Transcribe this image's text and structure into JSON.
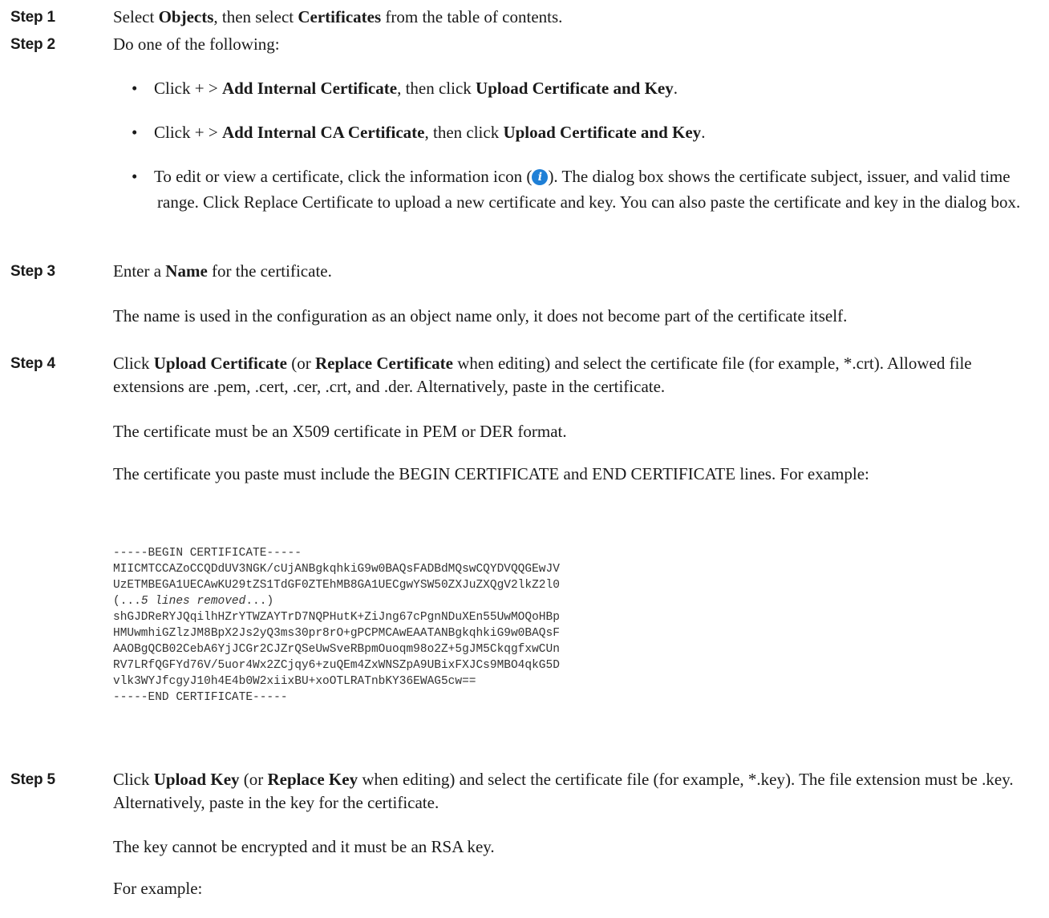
{
  "steps": [
    {
      "label": "Step 1",
      "text_a": "Select ",
      "bold_a": "Objects",
      "text_b": ", then select ",
      "bold_b": "Certificates",
      "text_c": " from the table of contents."
    },
    {
      "label": "Step 2",
      "text": "Do one of the following:",
      "bullets": [
        {
          "text_a": "Click + > ",
          "bold_a": "Add Internal Certificate",
          "text_b": ", then click ",
          "bold_b": "Upload Certificate and Key",
          "text_c": "."
        },
        {
          "text_a": "Click + > ",
          "bold_a": "Add Internal CA Certificate",
          "text_b": ", then click ",
          "bold_b": "Upload Certificate and Key",
          "text_c": "."
        },
        {
          "text_a": "To edit or view a certificate, click the information icon (",
          "icon": "info-icon",
          "text_b": "). The dialog box shows the certificate subject, issuer, and valid time range. Click Replace Certificate to upload a new certificate and key. You can also paste the certificate and key in the dialog box."
        }
      ]
    },
    {
      "label": "Step 3",
      "text_a": "Enter a ",
      "bold_a": "Name",
      "text_b": " for the certificate.",
      "para": "The name is used in the configuration as an object name only, it does not become part of the certificate itself."
    },
    {
      "label": "Step 4",
      "text_a": "Click ",
      "bold_a": "Upload Certificate",
      "text_b": " (or ",
      "bold_b": "Replace Certificate",
      "text_c": " when editing) and select the certificate file (for example, *.crt). Allowed file extensions are .pem, .cert, .cer, .crt, and .der. Alternatively, paste in the certificate.",
      "para1": "The certificate must be an X509 certificate in PEM or DER format.",
      "para2": "The certificate you paste must include the BEGIN CERTIFICATE and END CERTIFICATE lines. For example:",
      "code": {
        "lines_a": [
          "-----BEGIN CERTIFICATE-----",
          "MIICMTCCAZoCCQDdUV3NGK/cUjANBgkqhkiG9w0BAQsFADBdMQswCQYDVQQGEwJV",
          "UzETMBEGA1UECAwKU29tZS1TdGF0ZTEhMB8GA1UECgwYSW50ZXJuZXQgV2lkZ2l0"
        ],
        "removed_open": "(...",
        "removed_italic": "5 lines removed",
        "removed_close": "...)",
        "lines_b": [
          "shGJDReRYJQqilhHZrYTWZAYTrD7NQPHutK+ZiJng67cPgnNDuXEn55UwMOQoHBp",
          "HMUwmhiGZlzJM8BpX2Js2yQ3ms30pr8rO+gPCPMCAwEAATANBgkqhkiG9w0BAQsF",
          "AAOBgQCB02CebA6YjJCGr2CJZrQSeUwSveRBpmOuoqm98o2Z+5gJM5CkqgfxwCUn",
          "RV7LRfQGFYd76V/5uor4Wx2ZCjqy6+zuQEm4ZxWNSZpA9UBixFXJCs9MBO4qkG5D",
          "vlk3WYJfcgyJ10h4E4b0W2xiixBU+xoOTLRATnbKY36EWAG5cw==",
          "-----END CERTIFICATE-----"
        ]
      }
    },
    {
      "label": "Step 5",
      "text_a": "Click ",
      "bold_a": "Upload Key",
      "text_b": " (or ",
      "bold_b": "Replace Key",
      "text_c": " when editing) and select the certificate file (for example, *.key). The file extension must be .key. Alternatively, paste in the key for the certificate.",
      "para1": "The key cannot be encrypted and it must be an RSA key.",
      "para2": "For example:"
    }
  ],
  "colors": {
    "text": "#1a1a1a",
    "code": "#333333",
    "info_icon": "#1e7fd6"
  }
}
